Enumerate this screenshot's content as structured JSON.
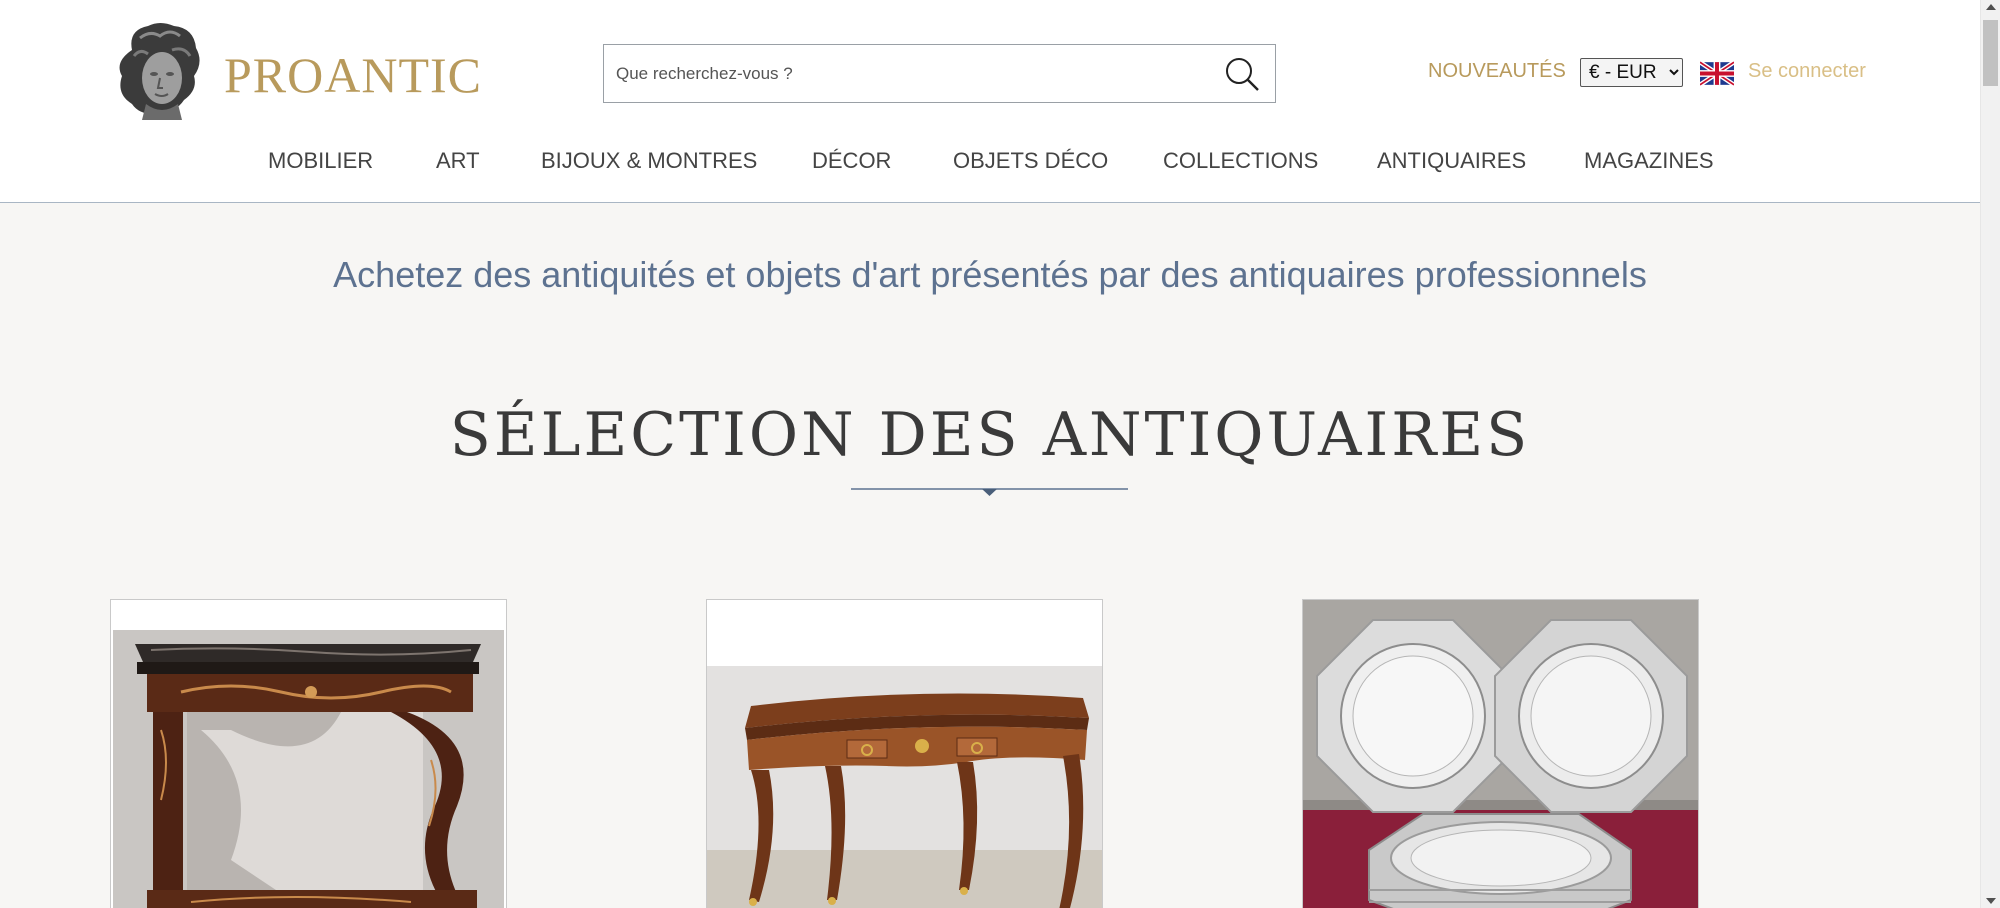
{
  "header": {
    "logo_text": "PROANTIC",
    "search": {
      "placeholder": "Que recherchez-vous ?",
      "value": ""
    },
    "nouveautes": "NOUVEAUTÉS",
    "currency": {
      "selected": "€ - EUR",
      "options": [
        "€ - EUR"
      ]
    },
    "language_flag": "uk-flag-icon",
    "login": "Se connecter"
  },
  "nav": {
    "items": [
      {
        "label": "MOBILIER"
      },
      {
        "label": "ART"
      },
      {
        "label": "BIJOUX & MONTRES"
      },
      {
        "label": "DÉCOR"
      },
      {
        "label": "OBJETS DÉCO"
      },
      {
        "label": "COLLECTIONS"
      },
      {
        "label": "ANTIQUAIRES"
      },
      {
        "label": "MAGAZINES"
      }
    ]
  },
  "main": {
    "tagline": "Achetez des antiquités et objets d'art présentés par des antiquaires professionnels",
    "section_title": "SÉLECTION DES ANTIQUAIRES",
    "products": [
      {
        "image": "marquetry-console-mirror-photo"
      },
      {
        "image": "louis-xv-bureau-plat-photo"
      },
      {
        "image": "octagonal-silver-plates-photo"
      }
    ]
  },
  "colors": {
    "brand_gold": "#b89a5c",
    "login_gold": "#d9bf86",
    "tagline_blue": "#5d7290",
    "background": "#f7f6f4"
  }
}
